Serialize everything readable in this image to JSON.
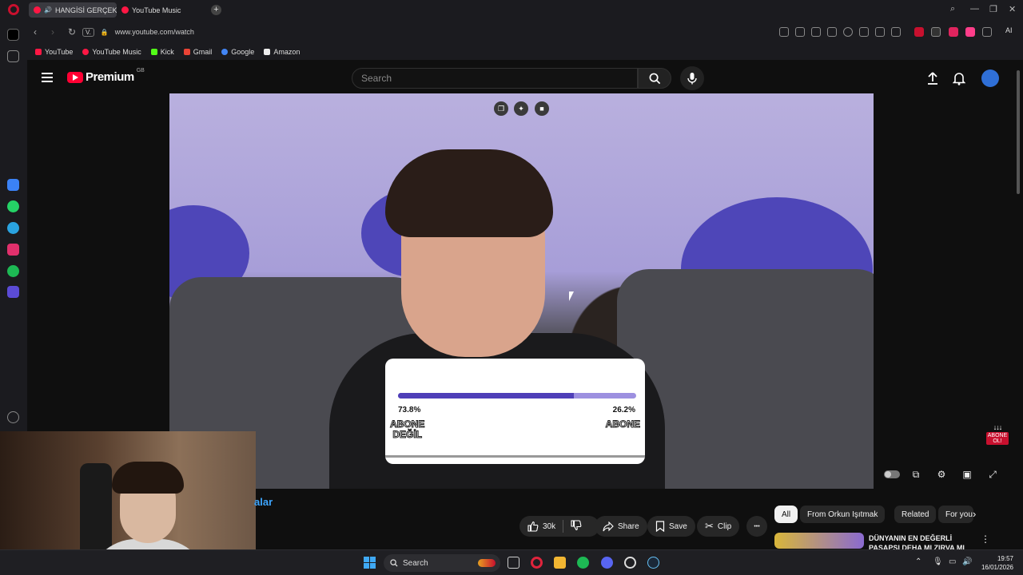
{
  "browser": {
    "tabs": [
      {
        "label": "HANGİSİ GERÇEK PİLO",
        "active": true
      },
      {
        "label": "YouTube Music",
        "active": false
      }
    ],
    "new_tab_glyph": "+",
    "url": "www.youtube.com/watch",
    "badge": "V.",
    "ai_label": "AI",
    "bookmarks": [
      {
        "label": "YouTube",
        "color": "#ff1744"
      },
      {
        "label": "YouTube Music",
        "color": "#ff1744"
      },
      {
        "label": "Kick",
        "color": "#53fc18"
      },
      {
        "label": "Gmail",
        "color": "#ea4335"
      },
      {
        "label": "Google",
        "color": "#4285f4"
      },
      {
        "label": "Amazon",
        "color": "#eeeeee"
      }
    ]
  },
  "youtube": {
    "logo_text": "Premium",
    "region": "GB",
    "search_placeholder": "Search"
  },
  "poll": {
    "left_pct": "73.8%",
    "right_pct": "26.2%",
    "left_fraction": 0.738,
    "left_label_line1": "ABONE",
    "left_label_line2": "DEĞİL",
    "right_label": "ABONE"
  },
  "badge": {
    "arrows": "↓↓↓",
    "line1": "ABONE",
    "line2": "OL!"
  },
  "video_meta": {
    "title_fragment": "alar",
    "like_count": "30k",
    "share_label": "Share",
    "save_label": "Save",
    "clip_label": "Clip",
    "more_glyph": "•••"
  },
  "chips": [
    "All",
    "From Orkun Işıtmak",
    "Related",
    "For you"
  ],
  "recommendation": {
    "title": "DÜNYANIN EN DEĞERLİ PASAPSI DEHA MI ZIRVA MI"
  },
  "taskbar": {
    "search_label": "Search",
    "time": "19:57",
    "date": "16/01/2026"
  }
}
